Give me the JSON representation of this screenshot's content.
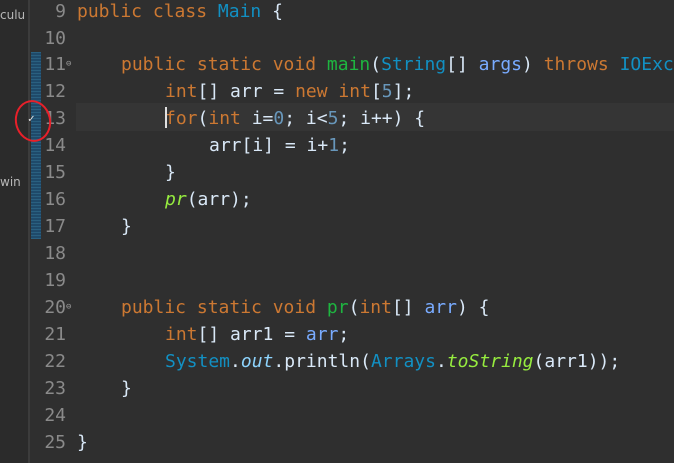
{
  "left_panel": {
    "frag1": "culu",
    "frag2": "win"
  },
  "gutter": {
    "line_numbers": [
      "9",
      "10",
      "11",
      "12",
      "13",
      "14",
      "15",
      "16",
      "17",
      "18",
      "19",
      "20",
      "21",
      "22",
      "23",
      "24",
      "25"
    ]
  },
  "code": {
    "l9": {
      "kw": "public class ",
      "name": "Main",
      "rest": " {"
    },
    "l11": {
      "mods": "public static void ",
      "name": "main",
      "p1": "(",
      "type": "String",
      "p2": "[] ",
      "param": "args",
      "p3": ") ",
      "throws": "throws ",
      "exc": "IOException"
    },
    "l12": {
      "type": "int",
      "a": "[] arr = ",
      "kw": "new ",
      "type2": "int",
      "b": "[",
      "num": "5",
      "c": "];"
    },
    "l13": {
      "kw": "for",
      "a": "(",
      "type": "int",
      "b": " i=",
      "n0": "0",
      "c": "; i<",
      "n5": "5",
      "d": "; i++) {"
    },
    "l14": {
      "a": "arr[i] = i+",
      "n1": "1",
      "b": ";"
    },
    "l15": "}",
    "l16": {
      "call": "pr",
      "rest": "(arr);"
    },
    "l17": "}",
    "l20": {
      "mods": "public static void ",
      "name": "pr",
      "a": "(",
      "type": "int",
      "b": "[] ",
      "param": "arr",
      "c": ") {"
    },
    "l21": {
      "type": "int",
      "a": "[] arr1 = ",
      "b": "arr",
      "c": ";"
    },
    "l22": {
      "cls": "System",
      "dot1": ".",
      "field": "out",
      "dot2": ".println(",
      "cls2": "Arrays",
      "dot3": ".",
      "st": "toString",
      "rest": "(arr1));"
    },
    "l23": "}",
    "l25": "}"
  },
  "colors": {
    "keyword": "#cc7832",
    "type": "#1290c3",
    "method": "#1eb540",
    "number": "#6897bb",
    "annotation_circle": "#e8202a"
  },
  "icons": {
    "breakpoint": "breakpoint-check-icon",
    "fold": "fold-minus-icon"
  }
}
